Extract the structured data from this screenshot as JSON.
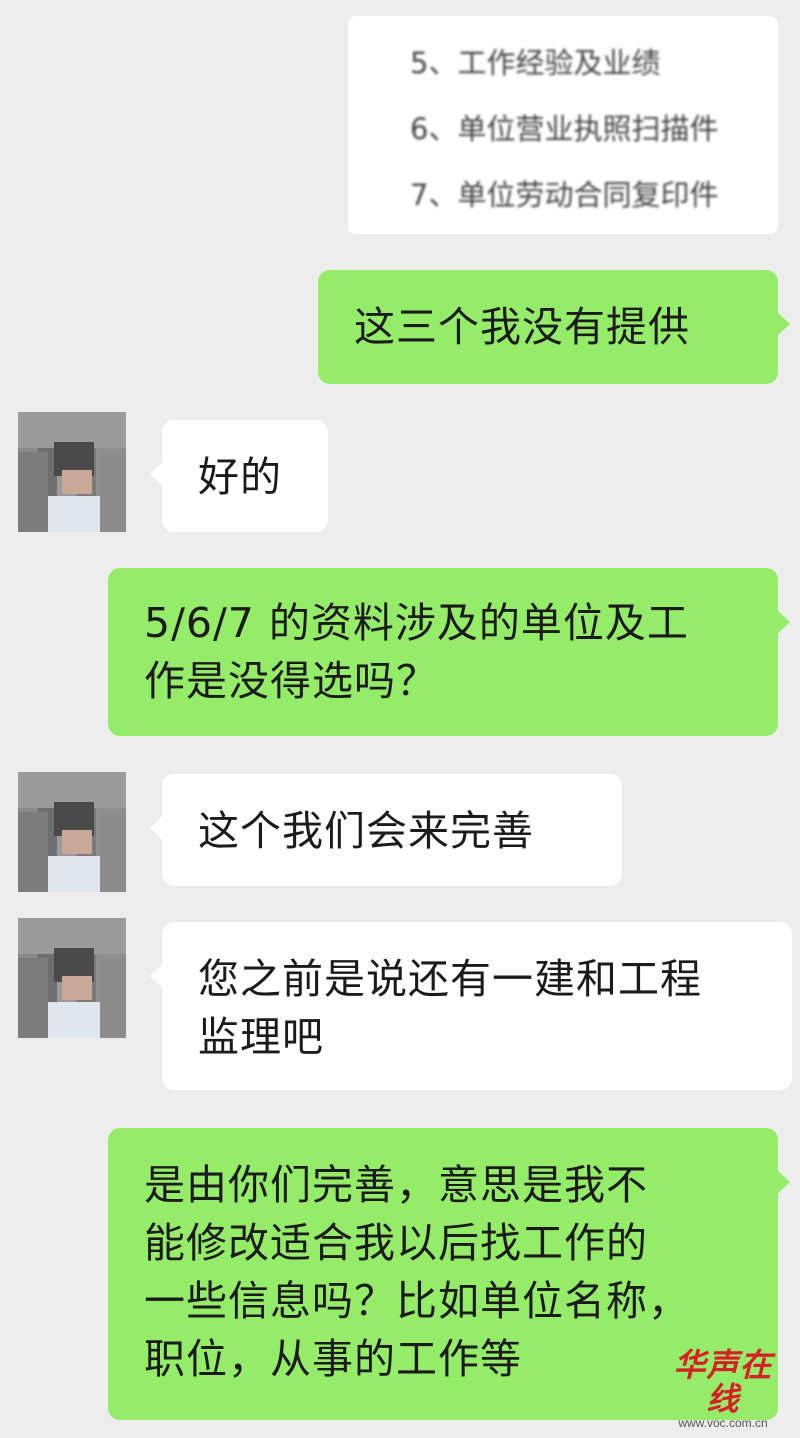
{
  "document_card": {
    "lines": [
      "5、工作经验及业绩",
      "6、单位营业执照扫描件",
      "7、单位劳动合同复印件"
    ]
  },
  "messages": [
    {
      "side": "right",
      "text": "这三个我没有提供"
    },
    {
      "side": "left",
      "text": "好的"
    },
    {
      "side": "right",
      "lines": [
        "5/6/7 的资料涉及的单位及工",
        "作是没得选吗？"
      ]
    },
    {
      "side": "left",
      "text": "这个我们会来完善"
    },
    {
      "side": "left",
      "lines": [
        "您之前是说还有一建和工程",
        "监理吧"
      ]
    },
    {
      "side": "right",
      "lines": [
        "是由你们完善，意思是我不",
        "能修改适合我以后找工作的",
        "一些信息吗？比如单位名称，",
        "职位，从事的工作等"
      ]
    }
  ],
  "watermark": {
    "brand": "华声在线",
    "url": "www.voc.com.cn"
  },
  "colors": {
    "background": "#ededed",
    "sent_bubble": "#95ec69",
    "received_bubble": "#ffffff",
    "watermark_red": "#d71f26"
  }
}
